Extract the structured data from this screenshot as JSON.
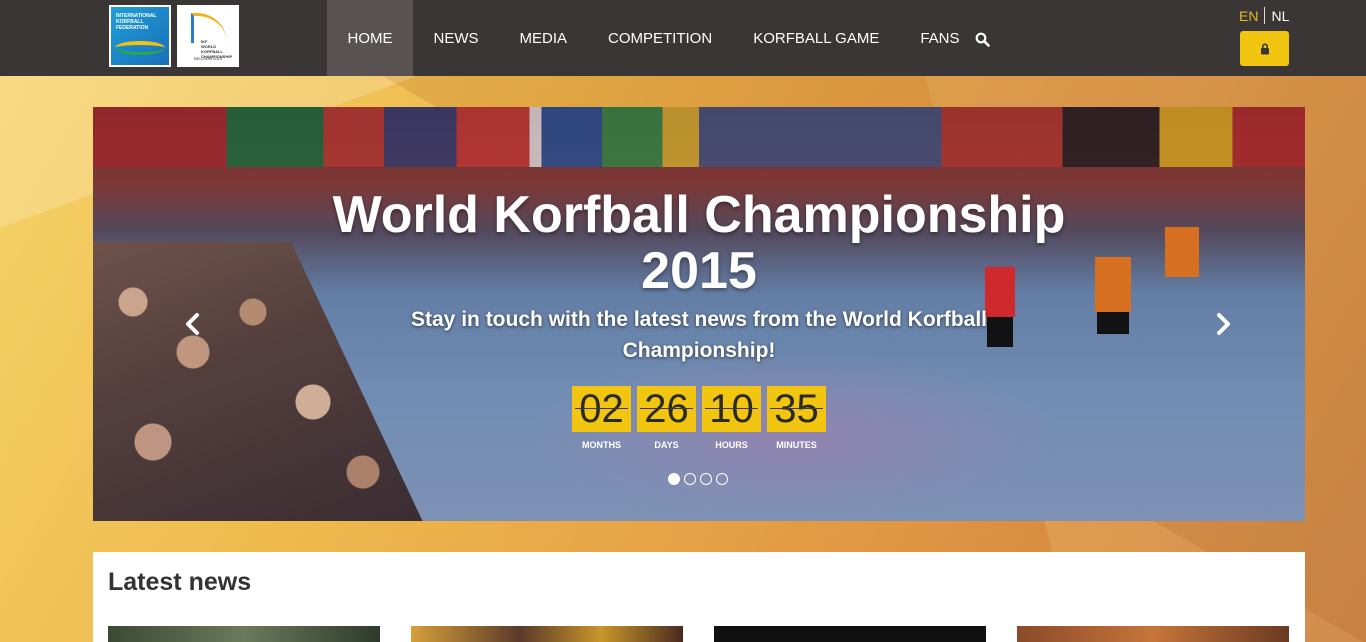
{
  "header": {
    "logos": [
      {
        "name": "ikf-logo",
        "alt": "INTERNATIONAL KORFBALL FEDERATION"
      },
      {
        "name": "world-korfball-championship-logo",
        "alt": "IKF WORLD KORFBALL CHAMPIONSHIP BELGIUM 2015"
      }
    ],
    "nav": [
      {
        "label": "HOME",
        "active": true
      },
      {
        "label": "NEWS",
        "active": false
      },
      {
        "label": "MEDIA",
        "active": false
      },
      {
        "label": "COMPETITION",
        "active": false
      },
      {
        "label": "KORFBALL GAME",
        "active": false
      },
      {
        "label": "FANS",
        "active": false
      }
    ],
    "search_icon": "search-icon",
    "languages": {
      "en": "EN",
      "nl": "NL",
      "selected": "EN"
    },
    "login_icon": "lock-icon"
  },
  "hero": {
    "title_line1": "World Korfball Championship",
    "title_line2": "2015",
    "subtitle": "Stay in touch with the latest news from the World Korfball Championship!",
    "countdown": [
      {
        "value": "02",
        "label": "MONTHS"
      },
      {
        "value": "26",
        "label": "DAYS"
      },
      {
        "value": "10",
        "label": "HOURS"
      },
      {
        "value": "35",
        "label": "MINUTES"
      }
    ],
    "slides": 4,
    "active_slide": 1
  },
  "news": {
    "title": "Latest news"
  },
  "colors": {
    "accent": "#f2c511",
    "header_bg": "#3a3636",
    "nav_active_bg": "#585253",
    "lang_active": "#e8b820"
  }
}
